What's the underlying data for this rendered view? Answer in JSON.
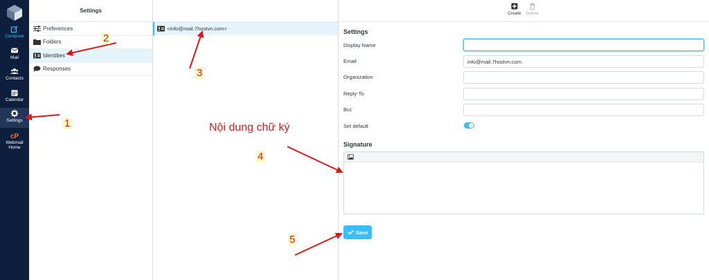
{
  "nav": {
    "items": [
      {
        "label": "Compose",
        "icon": "compose-icon"
      },
      {
        "label": "Mail",
        "icon": "envelope-icon"
      },
      {
        "label": "Contacts",
        "icon": "contacts-icon"
      },
      {
        "label": "Calendar",
        "icon": "calendar-icon"
      },
      {
        "label": "Settings",
        "icon": "gear-icon"
      },
      {
        "label": "Webmail",
        "label2": "Home",
        "icon": "cpanel-icon"
      }
    ]
  },
  "settings_menu": {
    "title": "Settings",
    "items": [
      {
        "label": "Preferences",
        "icon": "sliders-icon"
      },
      {
        "label": "Folders",
        "icon": "folder-icon"
      },
      {
        "label": "Identities",
        "icon": "id-card-icon"
      },
      {
        "label": "Responses",
        "icon": "comment-icon"
      }
    ]
  },
  "identities": {
    "items": [
      {
        "label": "<info@mail.7hostvn.com>",
        "icon": "id-card-icon"
      }
    ]
  },
  "toolbar": {
    "create_label": "Create",
    "delete_label": "Delete"
  },
  "form": {
    "section_title": "Settings",
    "display_name_label": "Display Name",
    "display_name_value": "",
    "email_label": "Email",
    "email_value": "info@mail.7hostvn.com",
    "organization_label": "Organization",
    "organization_value": "",
    "reply_to_label": "Reply-To",
    "reply_to_value": "",
    "bcc_label": "Bcc",
    "bcc_value": "",
    "set_default_label": "Set default",
    "set_default_on": true,
    "signature_title": "Signature",
    "save_label": "Save"
  },
  "annotations": {
    "n1": "1",
    "n2": "2",
    "n3": "3",
    "n4": "4",
    "n5": "5",
    "signature_note": "Nội dung chữ ký"
  },
  "colors": {
    "nav_bg": "#0e1f3d",
    "accent": "#37beff",
    "annotation_red": "#d31c1c",
    "selected_row": "#e5f3fa"
  }
}
